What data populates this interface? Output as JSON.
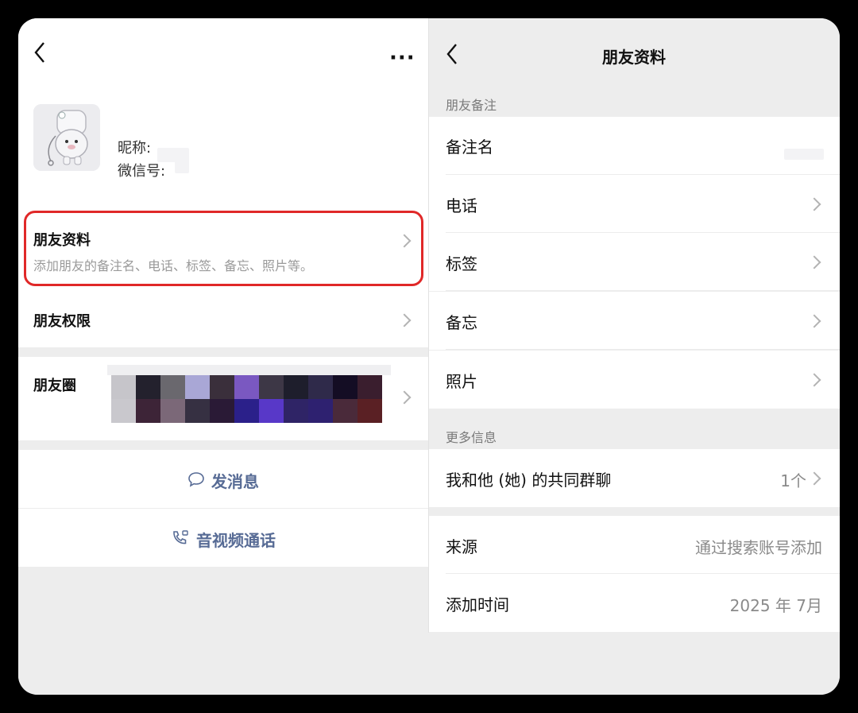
{
  "left": {
    "more_label": "···",
    "profile": {
      "nickname_label": "昵称:",
      "wechat_id_label": "微信号:"
    },
    "friend_profile": {
      "title": "朋友资料",
      "subtitle": "添加朋友的备注名、电话、标签、备忘、照片等。"
    },
    "permissions": {
      "title": "朋友权限"
    },
    "moments": {
      "title": "朋友圈"
    },
    "actions": {
      "message": "发消息",
      "call": "音视频通话"
    },
    "highlight_color": "#e02828",
    "link_color": "#576b95"
  },
  "right": {
    "title": "朋友资料",
    "section_remark": "朋友备注",
    "items": [
      {
        "label": "备注名",
        "value": ""
      },
      {
        "label": "电话",
        "value": ""
      },
      {
        "label": "标签",
        "value": ""
      },
      {
        "label": "备忘",
        "value": ""
      },
      {
        "label": "照片",
        "value": ""
      }
    ],
    "section_more": "更多信息",
    "common_groups": {
      "label": "我和他 (她) 的共同群聊",
      "value": "1个"
    },
    "source": {
      "label": "来源",
      "value": "通过搜索账号添加"
    },
    "added_time": {
      "label": "添加时间",
      "value": "2025 年 7月"
    }
  },
  "icons": {
    "back": "back-chevron-icon",
    "more": "more-dots-icon",
    "message": "chat-bubble-icon",
    "call": "phone-video-icon",
    "chevron": "chevron-right-icon"
  }
}
